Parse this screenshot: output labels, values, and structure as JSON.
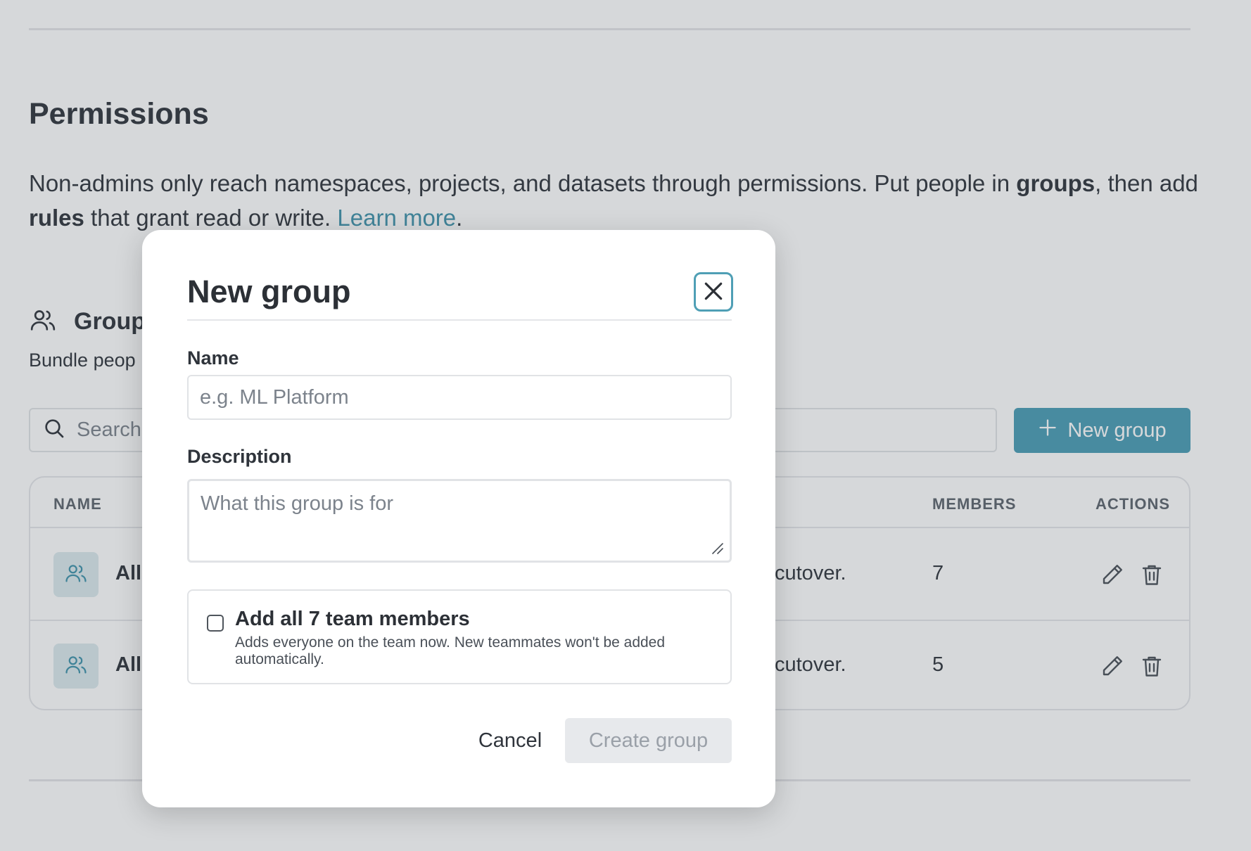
{
  "permissions": {
    "title": "Permissions",
    "desc_part1": "Non-admins only reach namespaces, projects, and datasets through permissions. Put people in ",
    "desc_groups": "groups",
    "desc_part2": ", then add ",
    "desc_rules": "rules",
    "desc_part3": " that grant read or write. ",
    "learn_more": "Learn more",
    "desc_end": "."
  },
  "groups": {
    "title": "Groups",
    "subtitle": "Bundle peop"
  },
  "search": {
    "placeholder": "Search"
  },
  "new_group_button": {
    "label": "New group",
    "icon": "plus-icon"
  },
  "table": {
    "columns": [
      "NAME",
      "MEMBERS",
      "ACTIONS"
    ],
    "rows": [
      {
        "name": "All",
        "description": "cutover.",
        "members": "7"
      },
      {
        "name": "All",
        "description": "cutover.",
        "members": "5"
      }
    ]
  },
  "modal": {
    "title": "New group",
    "name_label": "Name",
    "name_placeholder": "e.g. ML Platform",
    "description_label": "Description",
    "description_placeholder": "What this group is for",
    "add_all_label": "Add all 7 team members",
    "add_all_help": "Adds everyone on the team now. New teammates won't be added automatically.",
    "add_all_checked": false,
    "cancel_label": "Cancel",
    "create_label": "Create group"
  },
  "colors": {
    "accent": "#4a9db5",
    "link": "#3f93ab",
    "text": "#2f343b",
    "disabled_bg": "#e7e9ec",
    "disabled_text": "#9aa0a8"
  }
}
